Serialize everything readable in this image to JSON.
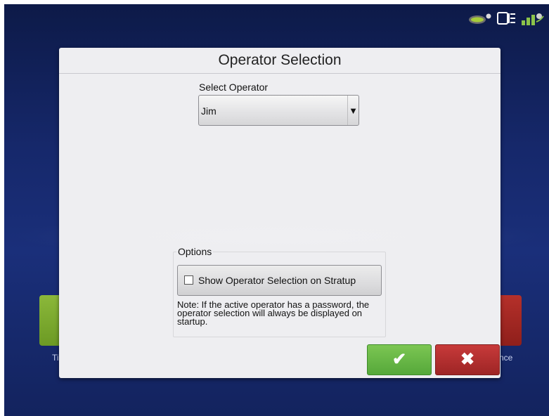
{
  "status_bar": {
    "icons": [
      "display-icon",
      "devices-icon",
      "gps-signal-icon"
    ]
  },
  "background": {
    "left_app_label": "Ti",
    "right_app_label": "nce"
  },
  "dialog": {
    "title": "Operator Selection",
    "select_operator_label": "Select Operator",
    "operator_value": "Jim",
    "dropdown_arrow": "▼",
    "options_label": "Options",
    "startup_option_label": "Show Operator Selection on Stratup",
    "startup_option_checked": false,
    "note": "Note: If the active operator has a password, the operator selection will always be displayed on startup.",
    "confirm_icon": "✔",
    "cancel_icon": "✖"
  },
  "colors": {
    "confirm": "#55a83a",
    "cancel": "#9e2525",
    "background": "#16286b"
  }
}
